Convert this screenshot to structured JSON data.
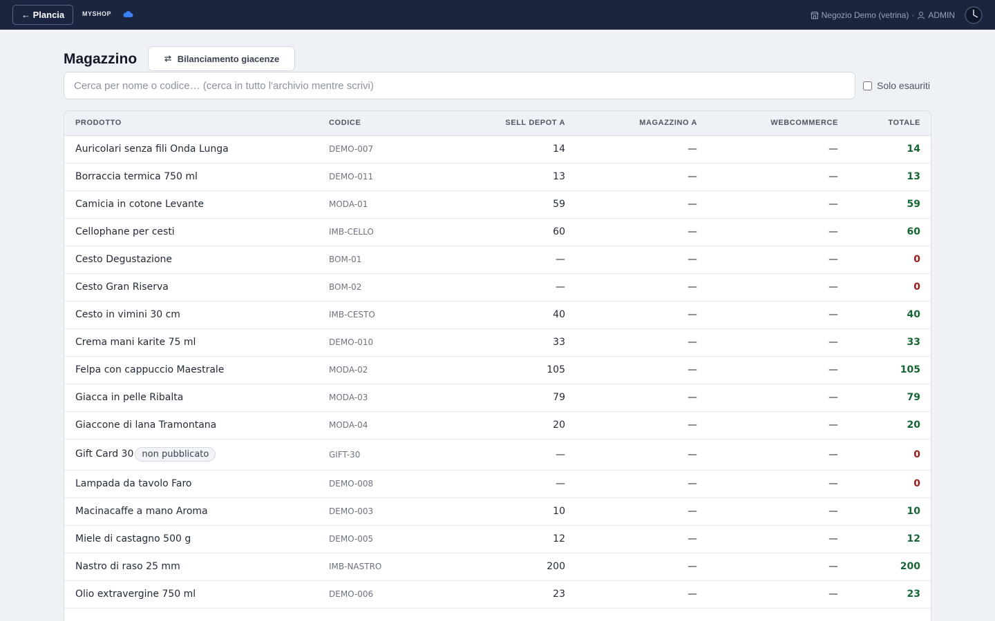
{
  "topbar": {
    "back_label": "← Plancia",
    "brand": "MYSHOP",
    "store": "Negozio Demo (vetrina)",
    "separator": "·",
    "user": "ADMIN"
  },
  "page": {
    "title": "Magazzino",
    "balance_button": "Bilanciamento giacenze",
    "search_placeholder": "Cerca per nome o codice… (cerca in tutto l'archivio mentre scrivi)",
    "solo_label": "Solo esauriti"
  },
  "table": {
    "headers": [
      "PRODOTTO",
      "CODICE",
      "SELL DEPOT A",
      "MAGAZZINO A",
      "WEBCOMMERCE",
      "TOTALE"
    ],
    "rows": [
      {
        "name": "Auricolari senza fili Onda Lunga",
        "badge": "",
        "code": "DEMO-007",
        "sell": "14",
        "mag": "—",
        "web": "—",
        "total": "14",
        "status": "pos"
      },
      {
        "name": "Borraccia termica 750 ml",
        "badge": "",
        "code": "DEMO-011",
        "sell": "13",
        "mag": "—",
        "web": "—",
        "total": "13",
        "status": "pos"
      },
      {
        "name": "Camicia in cotone Levante",
        "badge": "",
        "code": "MODA-01",
        "sell": "59",
        "mag": "—",
        "web": "—",
        "total": "59",
        "status": "pos"
      },
      {
        "name": "Cellophane per cesti",
        "badge": "",
        "code": "IMB-CELLO",
        "sell": "60",
        "mag": "—",
        "web": "—",
        "total": "60",
        "status": "pos"
      },
      {
        "name": "Cesto Degustazione",
        "badge": "",
        "code": "BOM-01",
        "sell": "—",
        "mag": "—",
        "web": "—",
        "total": "0",
        "status": "zero"
      },
      {
        "name": "Cesto Gran Riserva",
        "badge": "",
        "code": "BOM-02",
        "sell": "—",
        "mag": "—",
        "web": "—",
        "total": "0",
        "status": "zero"
      },
      {
        "name": "Cesto in vimini 30 cm",
        "badge": "",
        "code": "IMB-CESTO",
        "sell": "40",
        "mag": "—",
        "web": "—",
        "total": "40",
        "status": "pos"
      },
      {
        "name": "Crema mani karite 75 ml",
        "badge": "",
        "code": "DEMO-010",
        "sell": "33",
        "mag": "—",
        "web": "—",
        "total": "33",
        "status": "pos"
      },
      {
        "name": "Felpa con cappuccio Maestrale",
        "badge": "",
        "code": "MODA-02",
        "sell": "105",
        "mag": "—",
        "web": "—",
        "total": "105",
        "status": "pos"
      },
      {
        "name": "Giacca in pelle Ribalta",
        "badge": "",
        "code": "MODA-03",
        "sell": "79",
        "mag": "—",
        "web": "—",
        "total": "79",
        "status": "pos"
      },
      {
        "name": "Giaccone di lana Tramontana",
        "badge": "",
        "code": "MODA-04",
        "sell": "20",
        "mag": "—",
        "web": "—",
        "total": "20",
        "status": "pos"
      },
      {
        "name": "Gift Card 30",
        "badge": "non pubblicato",
        "code": "GIFT-30",
        "sell": "—",
        "mag": "—",
        "web": "—",
        "total": "0",
        "status": "zero"
      },
      {
        "name": "Lampada da tavolo Faro",
        "badge": "",
        "code": "DEMO-008",
        "sell": "—",
        "mag": "—",
        "web": "—",
        "total": "0",
        "status": "zero"
      },
      {
        "name": "Macinacaffe a mano Aroma",
        "badge": "",
        "code": "DEMO-003",
        "sell": "10",
        "mag": "—",
        "web": "—",
        "total": "10",
        "status": "pos"
      },
      {
        "name": "Miele di castagno 500 g",
        "badge": "",
        "code": "DEMO-005",
        "sell": "12",
        "mag": "—",
        "web": "—",
        "total": "12",
        "status": "pos"
      },
      {
        "name": "Nastro di raso 25 mm",
        "badge": "",
        "code": "IMB-NASTRO",
        "sell": "200",
        "mag": "—",
        "web": "—",
        "total": "200",
        "status": "pos"
      },
      {
        "name": "Olio extravergine 750 ml",
        "badge": "",
        "code": "DEMO-006",
        "sell": "23",
        "mag": "—",
        "web": "—",
        "total": "23",
        "status": "pos"
      }
    ]
  },
  "colors": {
    "topbar": "#1b2540",
    "total_positive": "#166534",
    "total_zero": "#991b1b",
    "cloud": "#3b82f6"
  },
  "icons": {
    "cloud": "cloud-icon",
    "store": "store-icon",
    "user": "user-icon",
    "clock": "clock-icon",
    "swap": "swap-icon"
  }
}
